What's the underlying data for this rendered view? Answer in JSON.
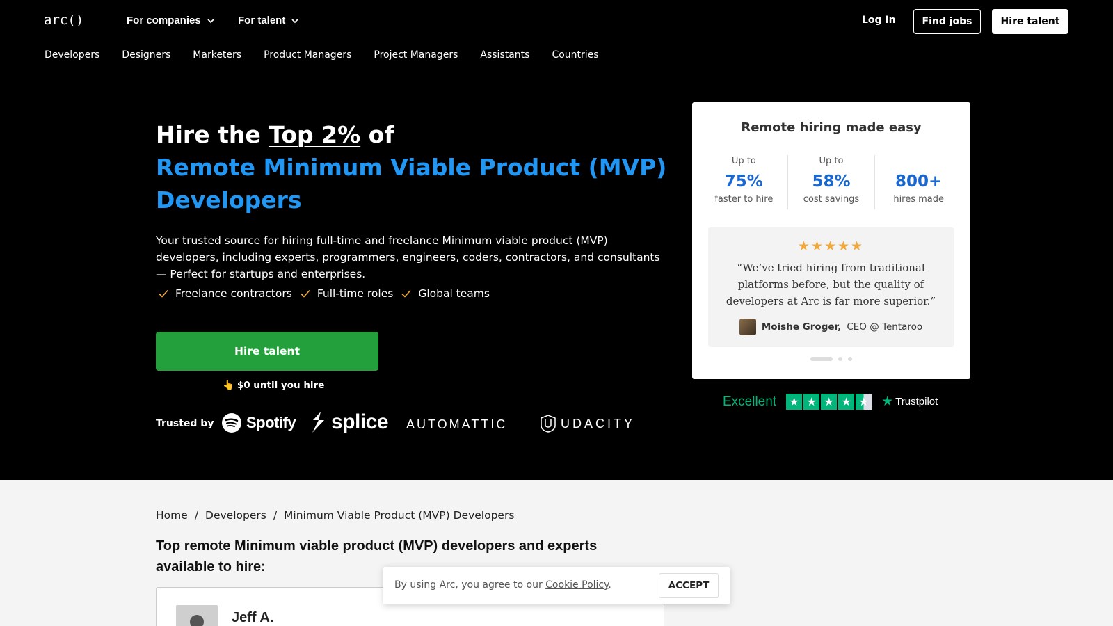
{
  "header": {
    "logo": "arc()",
    "menus": [
      {
        "label": "For companies"
      },
      {
        "label": "For talent"
      }
    ],
    "login": "Log In",
    "find_jobs": "Find jobs",
    "hire_talent": "Hire talent"
  },
  "subnav": [
    "Developers",
    "Designers",
    "Marketers",
    "Product Managers",
    "Project Managers",
    "Assistants",
    "Countries"
  ],
  "hero": {
    "title_prefix": "Hire the ",
    "title_highlight": "Top 2%",
    "title_suffix": " of",
    "title_blue_line1": "Remote Minimum Viable Product (MVP)",
    "title_blue_line2": "Developers",
    "description": "Your trusted source for hiring full-time and freelance Minimum viable product (MVP) developers, including experts, programmers, engineers, coders, contractors, and consultants — Perfect for startups and enterprises.",
    "features": [
      "Freelance contractors",
      "Full-time roles",
      "Global teams"
    ],
    "cta": "Hire talent",
    "note_emoji": "👆",
    "note": "$0 until you hire",
    "trusted_by": "Trusted by",
    "brands": [
      "Spotify",
      "splice",
      "AUTOMATTIC",
      "UDACITY"
    ]
  },
  "card": {
    "title": "Remote hiring made easy",
    "stats": [
      {
        "prefix": "Up to",
        "value": "75%",
        "label": "faster to hire"
      },
      {
        "prefix": "Up to",
        "value": "58%",
        "label": "cost savings"
      },
      {
        "prefix": "",
        "value": "800+",
        "label": "hires made"
      }
    ],
    "stars": "★★★★★",
    "quote": "“We’ve tried hiring from traditional platforms before, but the quality of developers at Arc is far more superior.”",
    "author_name": "Moishe Groger,",
    "author_role": "CEO @ Tentaroo"
  },
  "trustpilot": {
    "rating_word": "Excellent",
    "stars": 4.5,
    "brand": "Trustpilot"
  },
  "lower": {
    "breadcrumb": {
      "home": "Home",
      "developers": "Developers",
      "current": "Minimum Viable Product (MVP) Developers",
      "separator": "/"
    },
    "section_title": "Top remote Minimum viable product (MVP) developers and experts available to hire:",
    "developer_name": "Jeff A."
  },
  "cookie": {
    "text_before": "By using Arc, you agree to our ",
    "policy": "Cookie Policy",
    "text_after": ".",
    "accept": "ACCEPT"
  },
  "colors": {
    "accent_blue": "#2196f3",
    "stat_blue": "#1967d2",
    "cta_green": "#23a03c",
    "star_gold": "#f2a93b",
    "trustpilot_green": "#00b67a"
  }
}
